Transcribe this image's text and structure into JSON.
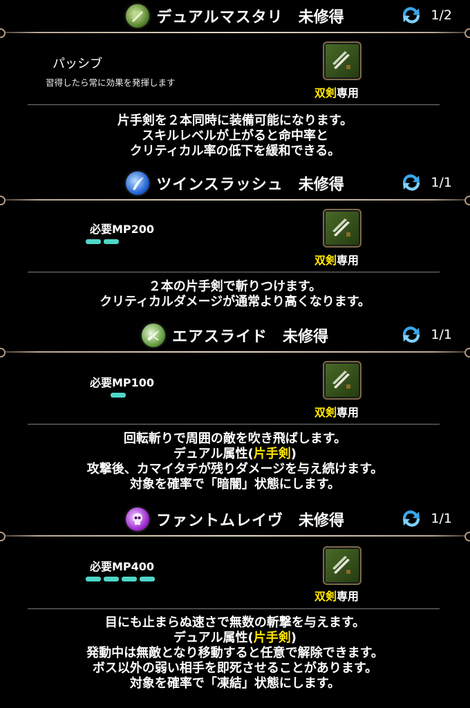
{
  "skills": [
    {
      "name": "デュアルマスタリ",
      "state": "未修得",
      "level": "1/2",
      "icon": "dual-mastery-icon",
      "condition_type": "パッシブ",
      "condition_desc": "習得したら常に効果を発揮します",
      "weapon_req_hl": "双剣",
      "weapon_req_rest": "専用",
      "description": [
        "片手剣を２本同時に装備可能になります。",
        "スキルレベルが上がると命中率と",
        "クリティカル率の低下を緩和できる。"
      ]
    },
    {
      "name": "ツインスラッシュ",
      "state": "未修得",
      "level": "1/1",
      "icon": "twin-slash-icon",
      "mp": "必要MP200",
      "mp_bars": 2,
      "weapon_req_hl": "双剣",
      "weapon_req_rest": "専用",
      "description": [
        "２本の片手剣で斬りつけます。",
        "クリティカルダメージが通常より高くなります。"
      ]
    },
    {
      "name": "エアスライド",
      "state": "未修得",
      "level": "1/1",
      "icon": "air-slide-icon",
      "mp": "必要MP100",
      "mp_bars": 1,
      "weapon_req_hl": "双剣",
      "weapon_req_rest": "専用",
      "description": [
        "回転斬りで周囲の敵を吹き飛ばします。",
        "デュアル属性(",
        "片手剣",
        ")",
        "攻撃後、カマイタチが残りダメージを与え続けます。",
        "対象を確率で「暗闇」状態にします。"
      ]
    },
    {
      "name": "ファントムレイヴ",
      "state": "未修得",
      "level": "1/1",
      "icon": "skull-icon",
      "mp": "必要MP400",
      "mp_bars": 4,
      "weapon_req_hl": "双剣",
      "weapon_req_rest": "専用",
      "description": [
        "目にも止まらぬ速さで無数の斬撃を与えます。",
        "デュアル属性(",
        "片手剣",
        ")",
        "発動中は無敵となり移動すると任意で解除できます。",
        "ボス以外の弱い相手を即死させることがあります。",
        "対象を確率で「凍結」状態にします。"
      ]
    }
  ],
  "colors": {
    "highlight": "#ffe600",
    "mp_bar": "#4fd6c9",
    "refresh_icon": "#3aa6e8"
  }
}
